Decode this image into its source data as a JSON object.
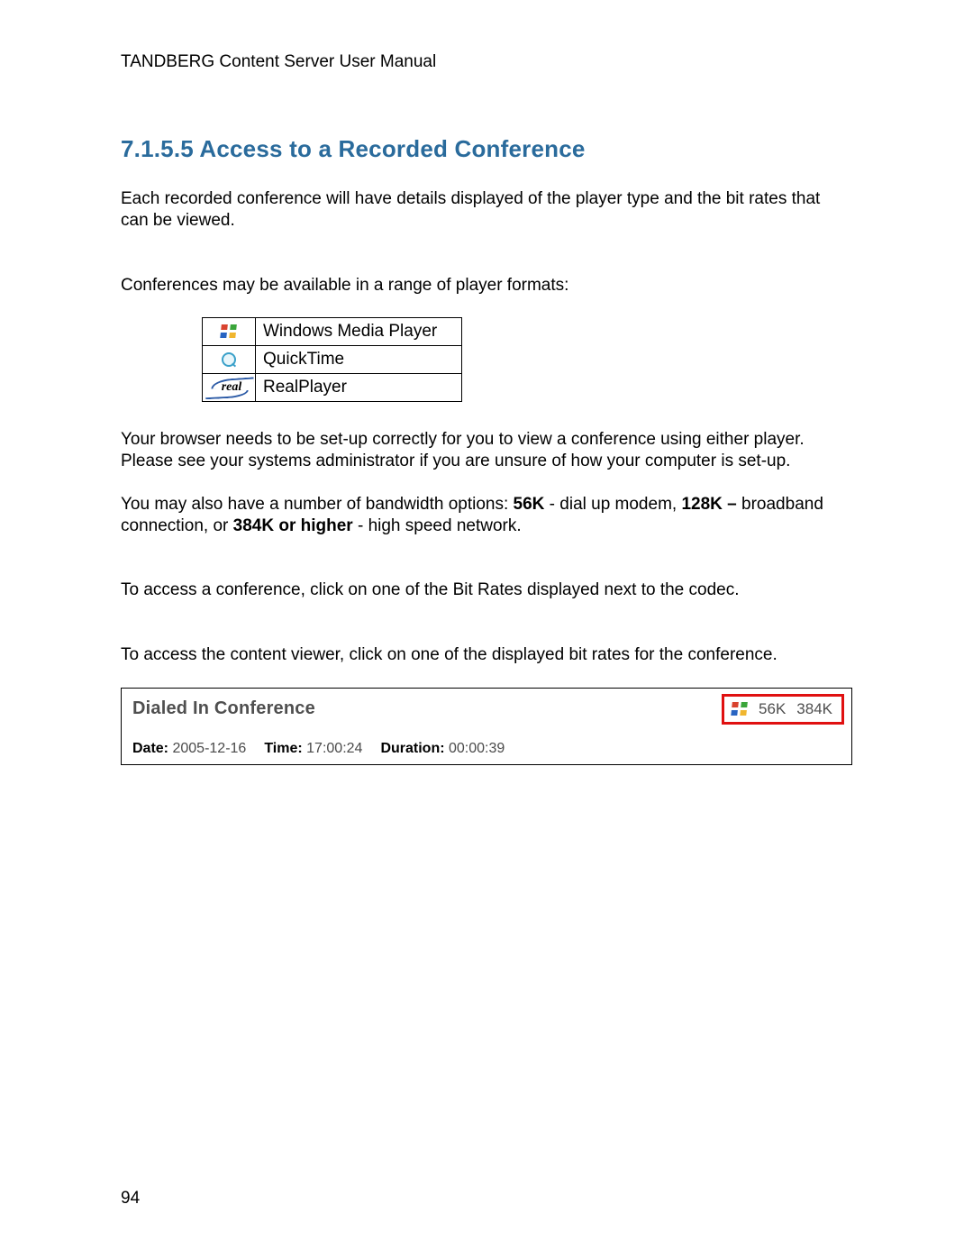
{
  "header": {
    "text": "TANDBERG Content Server User Manual"
  },
  "section": {
    "number": "7.1.5.5",
    "title": "Access to a Recorded Conference"
  },
  "paragraphs": {
    "intro": "Each recorded conference will have details displayed of the player type and the bit rates that can be viewed.",
    "formats_lead": "Conferences may be available in a range of player formats:",
    "browser_note": "Your browser needs to be set-up correctly for you to view a conference using either player. Please see your systems administrator if you are unsure of how your computer is set-up.",
    "bandwidth_pre": "You may also have a number of bandwidth options: ",
    "bw_56k": "56K",
    "bw_56k_desc": " - dial up modem, ",
    "bw_128k": "128K –",
    "bw_128k_desc": " broadband connection, or ",
    "bw_384k": "384K or higher",
    "bw_384k_desc": " - high speed network.",
    "access_conf": "To access a conference, click on one of the Bit Rates displayed next to the codec.",
    "access_viewer": "To access the content viewer, click on one of the displayed bit rates for the conference."
  },
  "players": {
    "wmp": "Windows Media Player",
    "qt": "QuickTime",
    "real_icon_text": "real",
    "real": "RealPlayer"
  },
  "conference": {
    "title": "Dialed In Conference",
    "bitrates": {
      "a": "56K",
      "b": "384K"
    },
    "date_label": "Date:",
    "date_value": "2005-12-16",
    "time_label": "Time:",
    "time_value": "17:00:24",
    "duration_label": "Duration:",
    "duration_value": "00:00:39"
  },
  "page_number": "94"
}
